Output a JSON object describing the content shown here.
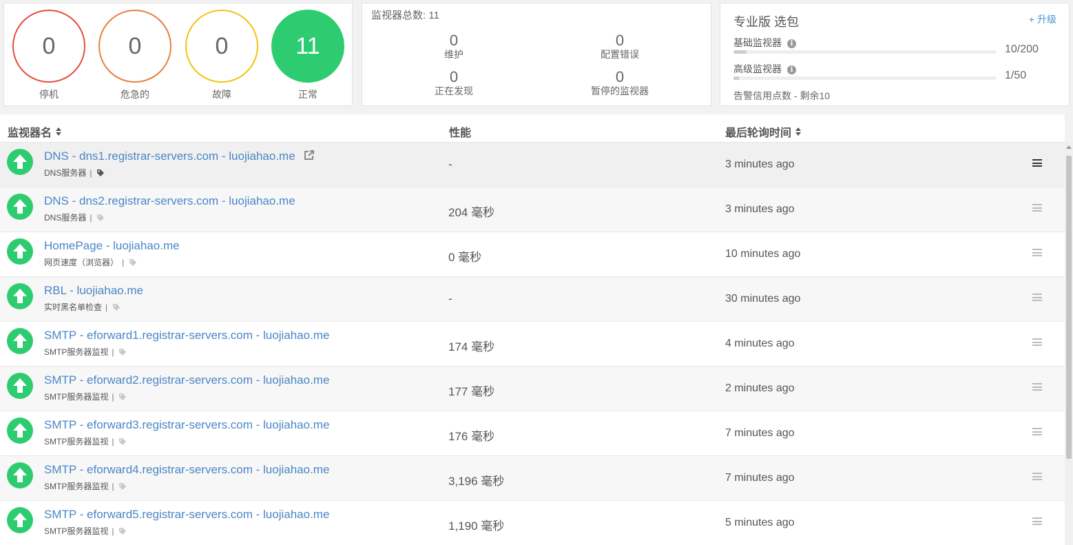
{
  "status_summary": [
    {
      "count": "0",
      "label": "停机",
      "color": "#e74c3c",
      "fill": false
    },
    {
      "count": "0",
      "label": "危急的",
      "color": "#e67e40",
      "fill": false
    },
    {
      "count": "0",
      "label": "故障",
      "color": "#f1c40f",
      "fill": false
    },
    {
      "count": "11",
      "label": "正常",
      "color": "#2ecc71",
      "fill": true
    }
  ],
  "counts": {
    "title": "监视器总数: 11",
    "maintenance": {
      "value": "0",
      "label": "维护"
    },
    "config_error": {
      "value": "0",
      "label": "配置错误"
    },
    "discovering": {
      "value": "0",
      "label": "正在发现"
    },
    "paused": {
      "value": "0",
      "label": "暂停的监视器"
    }
  },
  "plan": {
    "title": "专业版 选包",
    "upgrade_label": "+ 升级",
    "basic": {
      "label": "基础监视器",
      "value": "10/200",
      "fraction": 0.05
    },
    "advanced": {
      "label": "高级监视器",
      "value": "1/50",
      "fraction": 0.02
    },
    "credits": "告警信用点数 - 剩余10"
  },
  "table": {
    "headers": {
      "name": "监视器名",
      "performance": "性能",
      "last_polled": "最后轮询时间"
    },
    "rows": [
      {
        "name": "DNS - dns1.registrar-servers.com - luojiahao.me",
        "type": "DNS服务器",
        "performance": "-",
        "last_polled": "3 minutes ago"
      },
      {
        "name": "DNS - dns2.registrar-servers.com - luojiahao.me",
        "type": "DNS服务器",
        "performance": "204 毫秒",
        "last_polled": "3 minutes ago"
      },
      {
        "name": "HomePage - luojiahao.me",
        "type": "网页速度（浏览器）",
        "performance": "0 毫秒",
        "last_polled": "10 minutes ago"
      },
      {
        "name": "RBL - luojiahao.me",
        "type": "实时黑名单检查",
        "performance": "-",
        "last_polled": "30 minutes ago"
      },
      {
        "name": "SMTP - eforward1.registrar-servers.com - luojiahao.me",
        "type": "SMTP服务器监视",
        "performance": "174 毫秒",
        "last_polled": "4 minutes ago"
      },
      {
        "name": "SMTP - eforward2.registrar-servers.com - luojiahao.me",
        "type": "SMTP服务器监视",
        "performance": "177 毫秒",
        "last_polled": "2 minutes ago"
      },
      {
        "name": "SMTP - eforward3.registrar-servers.com - luojiahao.me",
        "type": "SMTP服务器监视",
        "performance": "176 毫秒",
        "last_polled": "7 minutes ago"
      },
      {
        "name": "SMTP - eforward4.registrar-servers.com - luojiahao.me",
        "type": "SMTP服务器监视",
        "performance": "3,196 毫秒",
        "last_polled": "7 minutes ago"
      },
      {
        "name": "SMTP - eforward5.registrar-servers.com - luojiahao.me",
        "type": "SMTP服务器监视",
        "performance": "1,190 毫秒",
        "last_polled": "5 minutes ago"
      }
    ]
  }
}
